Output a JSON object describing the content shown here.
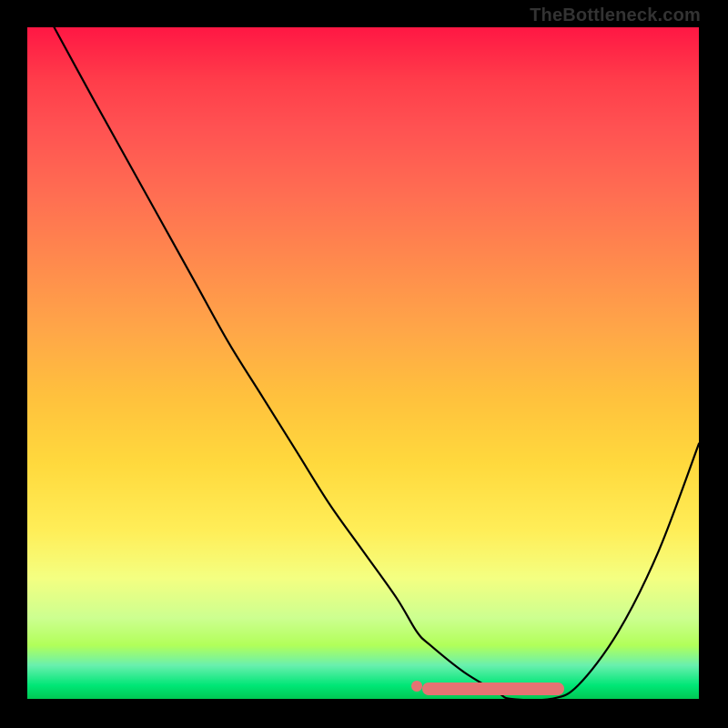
{
  "watermark": "TheBottleneck.com",
  "chart_data": {
    "type": "line",
    "title": "",
    "xlabel": "",
    "ylabel": "",
    "xlim": [
      0,
      100
    ],
    "ylim": [
      0,
      100
    ],
    "x": [
      4,
      10,
      15,
      20,
      25,
      30,
      35,
      40,
      45,
      50,
      55,
      58,
      60,
      65,
      70,
      72,
      78,
      82,
      88,
      94,
      100
    ],
    "values": [
      100,
      89,
      80,
      71,
      62,
      53,
      45,
      37,
      29,
      22,
      15,
      10,
      8,
      4,
      1,
      0,
      0,
      2,
      10,
      22,
      38
    ],
    "flat_region": {
      "x_start": 58,
      "x_end": 80,
      "y": 1.5
    },
    "background_gradient": {
      "top": "#ff1744",
      "middle": "#ffd93d",
      "bottom": "#00c853"
    }
  }
}
